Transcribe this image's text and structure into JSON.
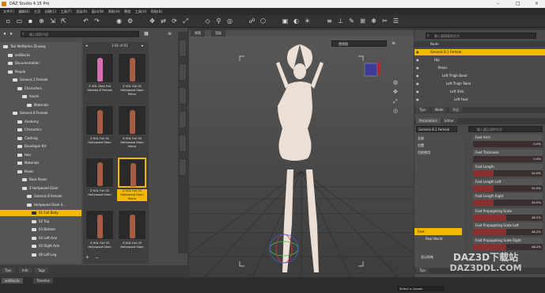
{
  "window": {
    "title": "DAZ Studio 4.15 Pro"
  },
  "menu": [
    "文件(F)",
    "编辑(E)",
    "主页",
    "创建(C)",
    "工具(T)",
    "渲染(R)",
    "窗口(W)",
    "帮助(H)",
    "教程",
    "工具(U)",
    "帮助(B)"
  ],
  "content_library": {
    "search_placeholder": "输入搜索内容",
    "tree": [
      {
        "label": "Tazi McMarlen Zhuang",
        "depth": 0
      },
      {
        "label": "aniBlocks",
        "depth": 1
      },
      {
        "label": "Documentation",
        "depth": 1
      },
      {
        "label": "People",
        "depth": 1
      },
      {
        "label": "Genesis 2 Female",
        "depth": 2
      },
      {
        "label": "Characters",
        "depth": 3
      },
      {
        "label": "Azumi",
        "depth": 4
      },
      {
        "label": "Materials",
        "depth": 5
      },
      {
        "label": "Genesis 8 Female",
        "depth": 2
      },
      {
        "label": "Anatomy",
        "depth": 3
      },
      {
        "label": "Characters",
        "depth": 3
      },
      {
        "label": "Clothing",
        "depth": 3
      },
      {
        "label": "Developer Kit",
        "depth": 3
      },
      {
        "label": "Hair",
        "depth": 3
      },
      {
        "label": "Materials",
        "depth": 3
      },
      {
        "label": "Poses",
        "depth": 3
      },
      {
        "label": "Base Poses",
        "depth": 4
      },
      {
        "label": "Z Hollywood Glam",
        "depth": 4
      },
      {
        "label": "Genesis 8 Female",
        "depth": 5
      },
      {
        "label": "Hollywood Glam S...",
        "depth": 5
      },
      {
        "label": "01 Full Body",
        "depth": 6,
        "selected": true
      },
      {
        "label": "02 Top",
        "depth": 6
      },
      {
        "label": "03 Bottom",
        "depth": 6
      },
      {
        "label": "04 Left Arm",
        "depth": 6
      },
      {
        "label": "05 Right Arm",
        "depth": 6
      },
      {
        "label": "06 Left Leg",
        "depth": 6
      }
    ],
    "pager": "1-01 of 01",
    "thumbnails": [
      {
        "label": "Z HGL Zero Full Genesis 8 Female",
        "fig_color": "#d46fb0"
      },
      {
        "label": "Z HGL Full 01 Hollywood Glam Mirror",
        "fig_color": "#a35e45"
      },
      {
        "label": "Z HGL Full 01 Hollywood Glam",
        "fig_color": "#a35e45"
      },
      {
        "label": "Z HGL Full 02 Hollywood Glam Mirror",
        "fig_color": "#a35e45"
      },
      {
        "label": "Z HGL Full 02 Hollywood Glam",
        "fig_color": "#a35e45"
      },
      {
        "label": "Z HGL Full 03 Hollywood Glam Mirror",
        "fig_color": "#a35e45",
        "selected": true
      },
      {
        "label": "Z HGL Full 03 Hollywood Glam",
        "fig_color": "#a35e45"
      },
      {
        "label": "Z HGL Full 04 Hollywood Glam",
        "fig_color": "#a35e45"
      }
    ],
    "bottom_tabs": [
      "Tips",
      "Info",
      "Tags"
    ]
  },
  "viewport": {
    "tabs": [
      "视图",
      "渲染"
    ],
    "camera": "透视图"
  },
  "scene": {
    "search_placeholder": "输入要搜索的名字",
    "header": "Node",
    "rows": [
      {
        "label": "Genesis 8.1 Female",
        "depth": 0,
        "selected": true
      },
      {
        "label": "Hip",
        "depth": 1
      },
      {
        "label": "Pelvis",
        "depth": 2
      },
      {
        "label": "Left Thigh Bend",
        "depth": 3
      },
      {
        "label": "Left Thigh Twist",
        "depth": 4
      },
      {
        "label": "Left Shin",
        "depth": 5
      },
      {
        "label": "Left Foot",
        "depth": 6
      }
    ],
    "tabs": [
      "Tips",
      "Node",
      "节点"
    ]
  },
  "parameters": {
    "tabs": [
      "Parameters",
      "Editor"
    ],
    "selector": "Genesis 8.1 Female",
    "search_placeholder": "输入要过滤的名字",
    "categories": [
      "全部",
      "位置",
      "目前使用"
    ],
    "props_items": [
      "Feet",
      "Real World",
      "显示所有"
    ],
    "sliders": [
      {
        "label": "Feet Arch",
        "value": "0.0%",
        "frac": 0.0
      },
      {
        "label": "Feet Thickness",
        "value": "0.0%",
        "frac": 0.0
      },
      {
        "label": "Foot Length",
        "value": "30.0%",
        "frac": 0.3
      },
      {
        "label": "Foot Length Left",
        "value": "30.0%",
        "frac": 0.3
      },
      {
        "label": "Foot Length Right",
        "value": "30.0%",
        "frac": 0.3
      },
      {
        "label": "Foot Propagating Scale",
        "value": "48.2%",
        "frac": 0.482
      },
      {
        "label": "Foot Propagating Scale Left",
        "value": "48.2%",
        "frac": 0.482
      },
      {
        "label": "Foot Propagating Scale Right",
        "value": "48.2%",
        "frac": 0.482
      }
    ],
    "bottom_tabs": [
      "Tips"
    ]
  },
  "bottom": {
    "tabs": [
      "aniBlocks",
      "Timeline"
    ],
    "lesson": "Select a Lesson"
  },
  "watermark": {
    "line1": "DAZ3D下载站",
    "line2": "DAZ3DDL.COM"
  },
  "colors": {
    "accent": "#f5b800",
    "slider_fill": "#8a2f2f"
  }
}
